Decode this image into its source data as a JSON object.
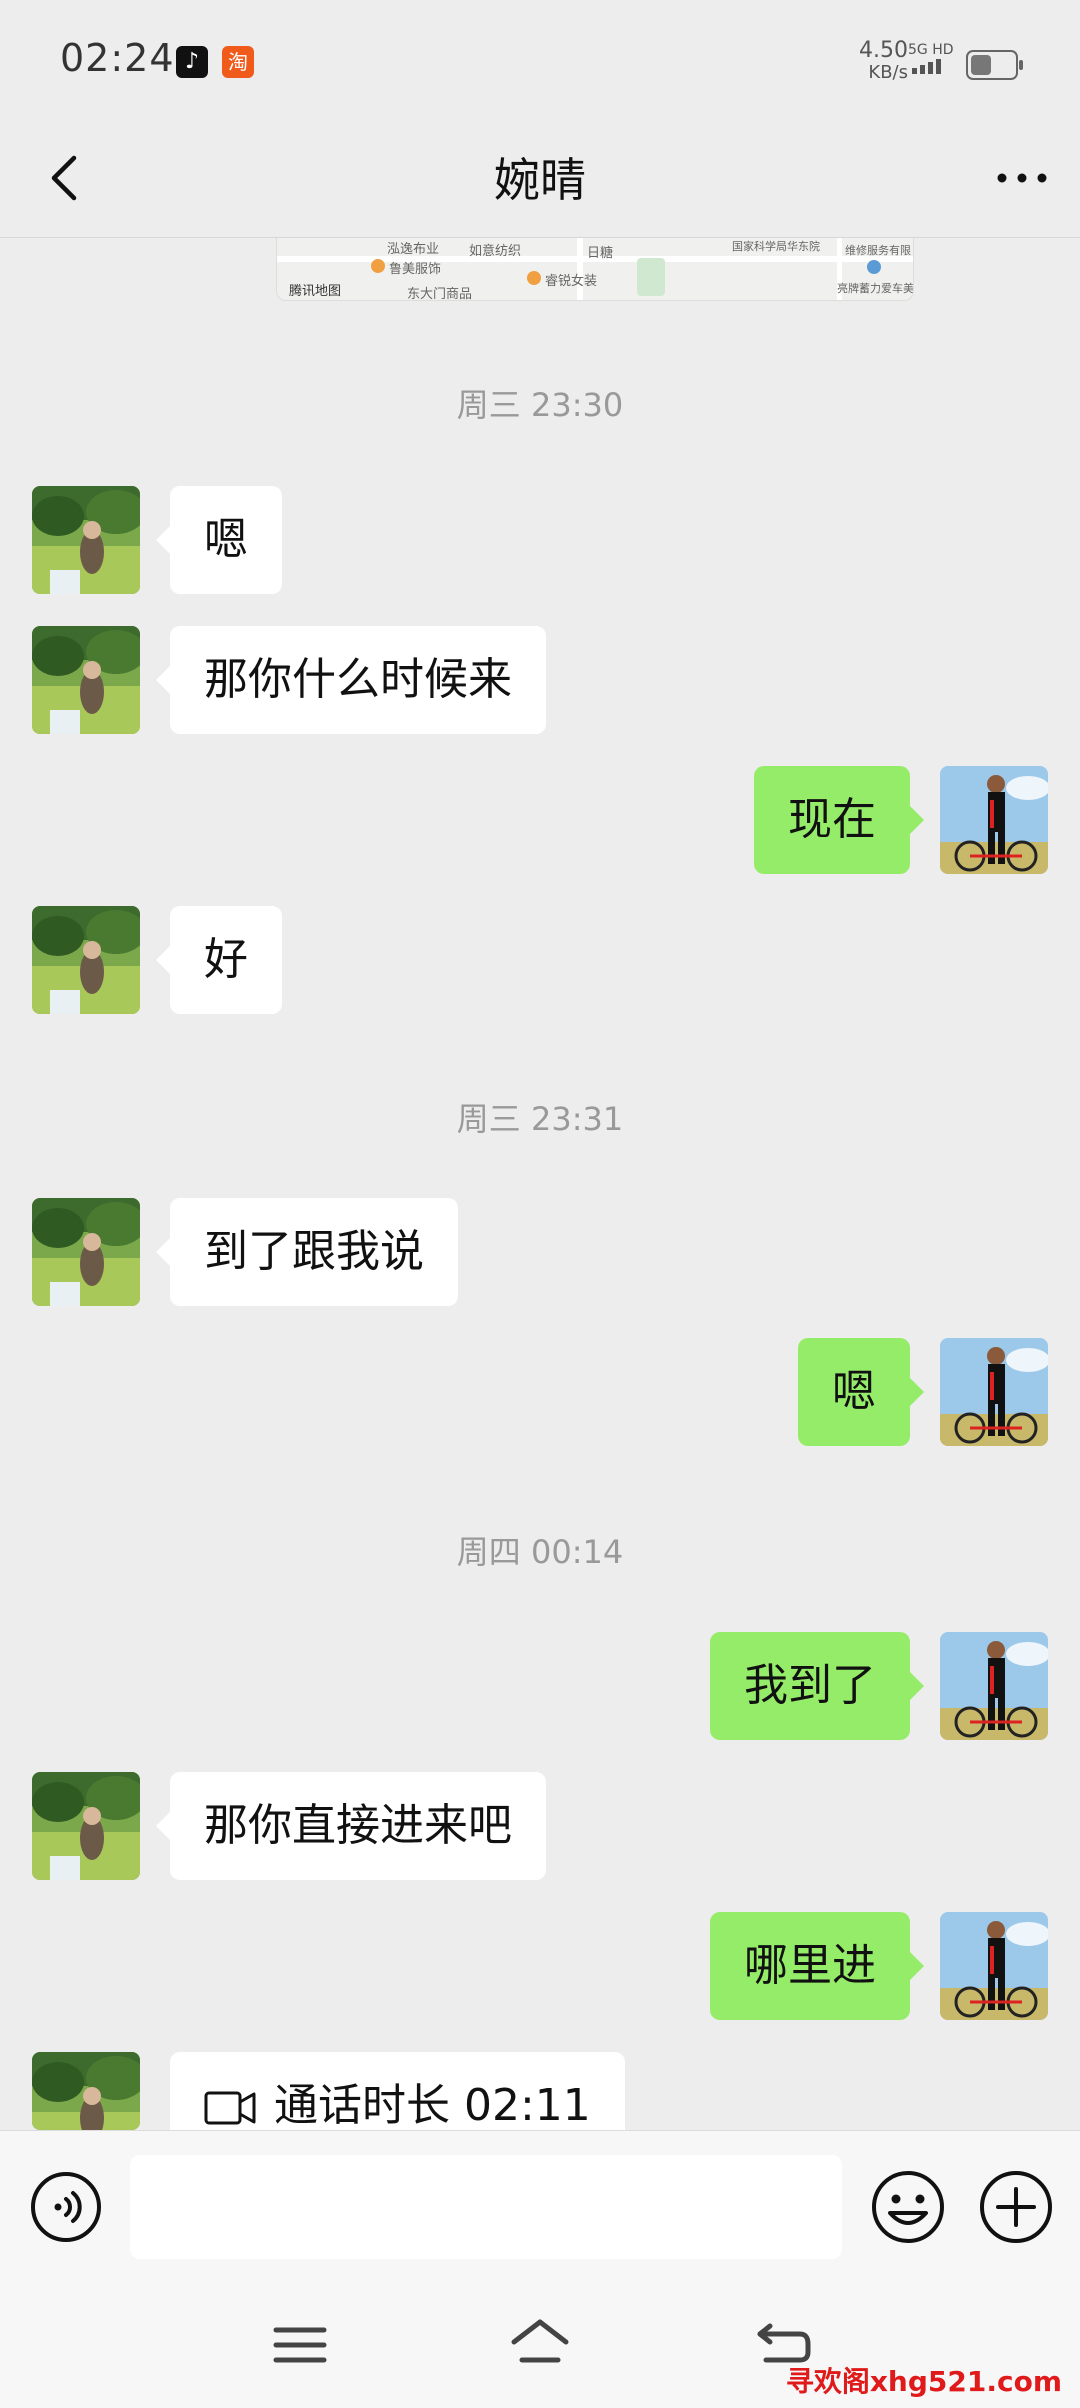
{
  "status_bar": {
    "time": "02:24",
    "app_icons": [
      {
        "name": "tiktok-icon",
        "glyph": "♪"
      },
      {
        "name": "taobao-icon",
        "glyph": "淘"
      }
    ],
    "net_speed": "4.50",
    "net_speed_unit": "KB/s",
    "network": "5G HD"
  },
  "chat": {
    "title": "婉晴"
  },
  "map_preview": {
    "labels": [
      "泓逸布业",
      "如意纺织",
      "日糖",
      "鲁美服饰",
      "睿锐女装",
      "腾讯地图",
      "东大门商品",
      "国家科学局华东院",
      "维修服务有限",
      "亮牌蓄力爱车美护中心"
    ]
  },
  "messages": [
    {
      "type": "timestamp",
      "text": "周三 23:30"
    },
    {
      "type": "received",
      "text": "嗯"
    },
    {
      "type": "received",
      "text": "那你什么时候来"
    },
    {
      "type": "sent",
      "text": "现在"
    },
    {
      "type": "received",
      "text": "好"
    },
    {
      "type": "timestamp",
      "text": "周三 23:31"
    },
    {
      "type": "received",
      "text": "到了跟我说"
    },
    {
      "type": "sent",
      "text": "嗯"
    },
    {
      "type": "timestamp",
      "text": "周四 00:14"
    },
    {
      "type": "sent",
      "text": "我到了"
    },
    {
      "type": "received",
      "text": "那你直接进来吧"
    },
    {
      "type": "sent",
      "text": "哪里进"
    },
    {
      "type": "received_call",
      "text": "通话时长 02:11"
    }
  ],
  "input": {
    "value": "",
    "placeholder": ""
  },
  "watermark": "寻欢阁xhg521.com",
  "colors": {
    "background": "#ededed",
    "sent_bubble": "#95ec69",
    "received_bubble": "#ffffff",
    "timestamp_text": "#999999"
  }
}
